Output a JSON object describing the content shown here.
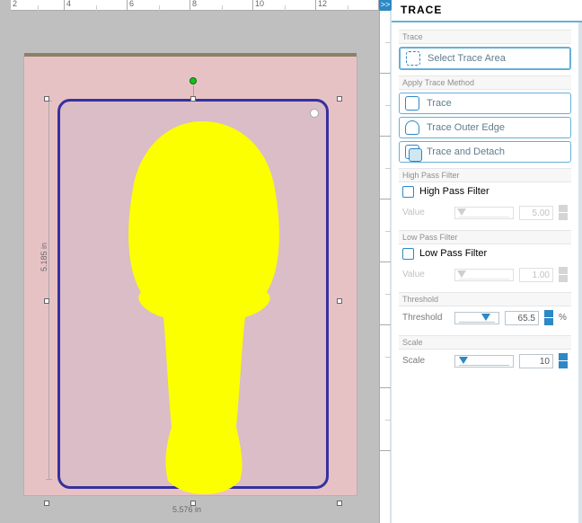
{
  "panel": {
    "title": "TRACE",
    "groups": {
      "trace_area": {
        "header": "Trace",
        "select_btn": "Select Trace Area"
      },
      "method": {
        "header": "Apply Trace Method",
        "trace": "Trace",
        "outer": "Trace Outer Edge",
        "detach": "Trace and Detach"
      },
      "hpf": {
        "header": "High Pass Filter",
        "chk_label": "High Pass Filter",
        "value_label": "Value",
        "value": "5.00"
      },
      "lpf": {
        "header": "Low Pass Filter",
        "chk_label": "Low Pass Filter",
        "value_label": "Value",
        "value": "1.00"
      },
      "threshold": {
        "header": "Threshold",
        "label": "Threshold",
        "value": "65.5",
        "unit": "%"
      },
      "scale": {
        "header": "Scale",
        "label": "Scale",
        "value": "10"
      }
    }
  },
  "rulers": {
    "h": [
      "2",
      "4",
      "6",
      "8",
      "10",
      "12"
    ]
  },
  "canvas": {
    "dim_w": "5.576 in",
    "dim_h": "5.185 in"
  },
  "collapse_glyph": ">>"
}
